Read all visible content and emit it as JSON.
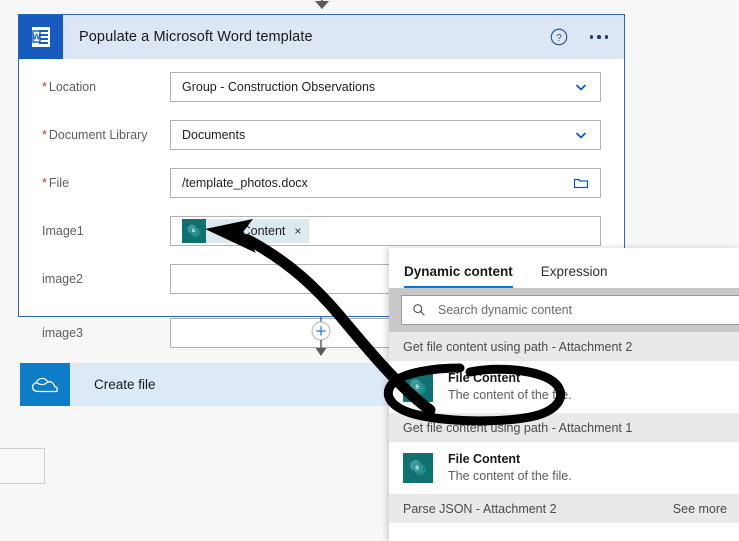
{
  "card": {
    "icon": "word-icon",
    "title": "Populate a Microsoft Word template",
    "help_icon": "help-circle-icon",
    "more_icon": "ellipsis-icon",
    "fields": [
      {
        "label": "Location",
        "required": true,
        "value": "Group - Construction Observations",
        "affordance": "chevron-down-icon",
        "name": "location"
      },
      {
        "label": "Document Library",
        "required": true,
        "value": "Documents",
        "affordance": "chevron-down-icon",
        "name": "document-library"
      },
      {
        "label": "File",
        "required": true,
        "value": "/template_photos.docx",
        "affordance": "folder-icon",
        "name": "file"
      },
      {
        "label": "Image1",
        "required": false,
        "value": "",
        "token": {
          "label": "File Content",
          "icon": "sharepoint-icon",
          "close": "×"
        },
        "affordance": "",
        "name": "image1"
      },
      {
        "label": "image2",
        "required": false,
        "value": "",
        "affordance": "",
        "name": "image2"
      },
      {
        "label": "image3",
        "required": false,
        "value": "",
        "affordance": "",
        "name": "image3"
      }
    ]
  },
  "connectors": {
    "top_arrow": "arrow-down-icon",
    "add_step": "plus-circle-icon",
    "add_step_arrow": "arrow-down-icon"
  },
  "create_file_card": {
    "icon": "onedrive-icon",
    "title": "Create file"
  },
  "dynamic_content": {
    "collapse_handle": "chevron-left-icon",
    "tabs": [
      {
        "label": "Dynamic content",
        "active": true
      },
      {
        "label": "Expression",
        "active": false
      }
    ],
    "search": {
      "icon": "search-icon",
      "placeholder": "Search dynamic content",
      "value": ""
    },
    "groups": [
      {
        "header": "Get file content using path - Attachment 2",
        "see_more": "",
        "items": [
          {
            "icon": "sharepoint-icon",
            "title": "File Content",
            "subtitle": "The content of the file.",
            "circled": true
          }
        ]
      },
      {
        "header": "Get file content using path - Attachment 1",
        "see_more": "",
        "items": [
          {
            "icon": "sharepoint-icon",
            "title": "File Content",
            "subtitle": "The content of the file.",
            "circled": false
          }
        ]
      },
      {
        "header": "Parse JSON - Attachment 2",
        "see_more": "See more",
        "items": []
      }
    ]
  },
  "annotation": {
    "type": "hand-drawn-marker",
    "color": "#000000",
    "shapes": [
      "ellipse-around-file-content-item",
      "curved-arrow-to-image2-field"
    ]
  },
  "colors": {
    "accent_blue": "#0078d4",
    "card_border": "#2c66b7",
    "header_bg": "#dce6f4",
    "word_blue": "#185abd",
    "onedrive_blue": "#0f7cc8",
    "sharepoint_teal": "#117070",
    "required_red": "#c0392b",
    "canvas_bg": "#f7f7f7"
  }
}
